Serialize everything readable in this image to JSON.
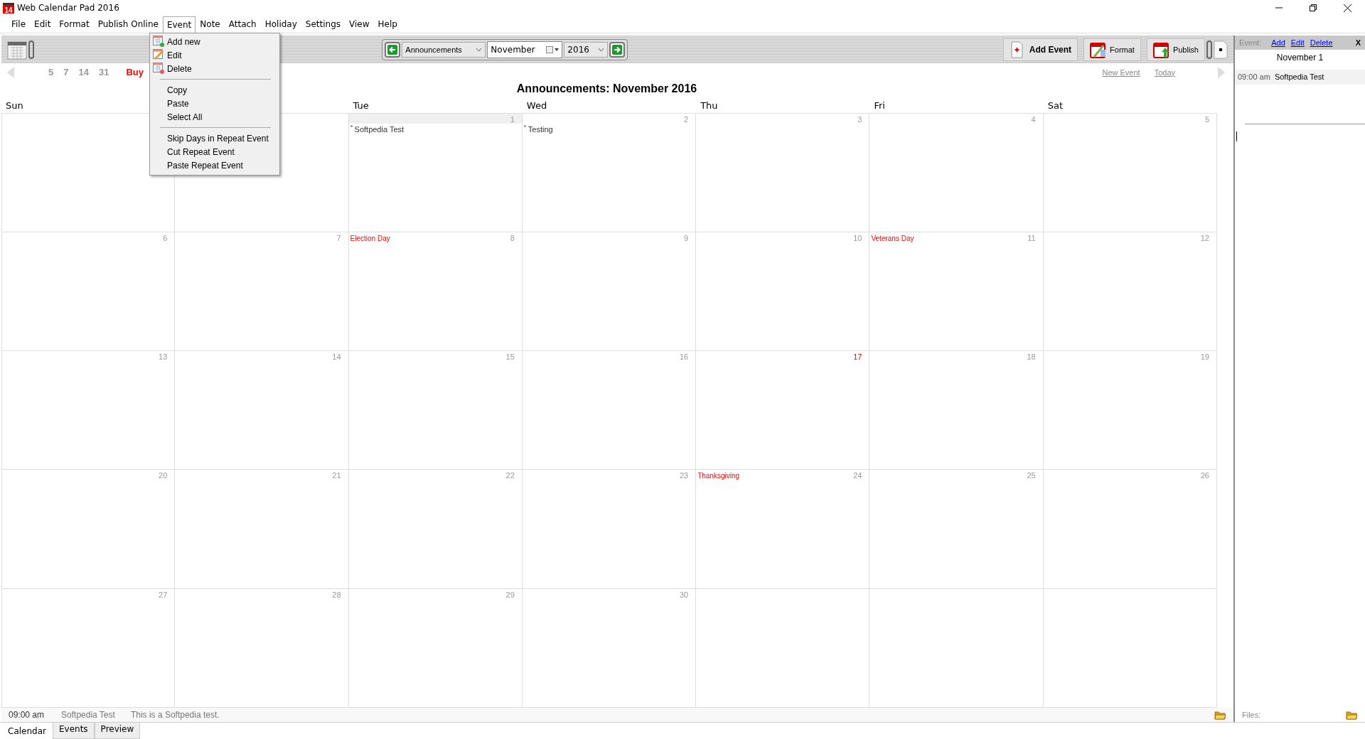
{
  "window": {
    "title": "Web Calendar Pad 2016",
    "app_icon_text": "14"
  },
  "menu": [
    {
      "label": "File",
      "selected": false
    },
    {
      "label": "Edit",
      "selected": false
    },
    {
      "label": "Format",
      "selected": false
    },
    {
      "label": "Publish Online",
      "selected": false
    },
    {
      "label": "Event",
      "selected": true
    },
    {
      "label": "Note",
      "selected": false
    },
    {
      "label": "Attach",
      "selected": false
    },
    {
      "label": "Holiday",
      "selected": false
    },
    {
      "label": "Settings",
      "selected": false
    },
    {
      "label": "View",
      "selected": false
    },
    {
      "label": "Help",
      "selected": false
    }
  ],
  "event_menu": [
    {
      "kind": "item",
      "label": "Add new"
    },
    {
      "kind": "item",
      "label": "Edit"
    },
    {
      "kind": "item",
      "label": "Delete"
    },
    {
      "kind": "separator"
    },
    {
      "kind": "item",
      "label": "Copy"
    },
    {
      "kind": "item",
      "label": "Paste"
    },
    {
      "kind": "item",
      "label": "Select All"
    },
    {
      "kind": "separator"
    },
    {
      "kind": "item",
      "label": "Skip Days in Repeat Event"
    },
    {
      "kind": "item",
      "label": "Cut Repeat Event"
    },
    {
      "kind": "item",
      "label": "Paste Repeat Event"
    }
  ],
  "toolbar": {
    "calendar_select": "Announcements",
    "month": "November",
    "year": "2016",
    "buttons": [
      "Add Event",
      "Format",
      "Publish"
    ]
  },
  "nav": {
    "ranges": [
      "5",
      "7",
      "14",
      "31"
    ],
    "buy": "Buy",
    "links": [
      "New Event",
      "Today"
    ]
  },
  "calendar": {
    "title": "Announcements:  November 2016",
    "weekdays": [
      {
        "kind": "label",
        "label": "Sun"
      },
      {
        "kind": "covered"
      },
      {
        "kind": "label",
        "label": "Tue"
      },
      {
        "kind": "label",
        "label": "Wed"
      },
      {
        "kind": "label",
        "label": "Thu"
      },
      {
        "kind": "label",
        "label": "Fri"
      },
      {
        "kind": "label",
        "label": "Sat"
      }
    ],
    "weeks": [
      [
        {
          "day": "1",
          "selected": true,
          "today": false,
          "events": [
            "Softpedia Test"
          ]
        },
        {
          "day": "2",
          "selected": false,
          "today": false,
          "events": [
            "Testing"
          ]
        },
        {
          "day": "3",
          "selected": false,
          "today": false
        },
        {
          "day": "4",
          "selected": false,
          "today": false
        },
        {
          "day": "5",
          "selected": false,
          "today": false
        }
      ],
      [
        {
          "day": "6",
          "selected": false,
          "today": false
        },
        {
          "day": "7",
          "selected": false,
          "today": false
        },
        {
          "day": "8",
          "selected": false,
          "today": false,
          "holiday": "Election Day"
        },
        {
          "day": "9",
          "selected": false,
          "today": false
        },
        {
          "day": "10",
          "selected": false,
          "today": false
        },
        {
          "day": "11",
          "selected": false,
          "today": false,
          "holiday": "Veterans Day"
        },
        {
          "day": "12",
          "selected": false,
          "today": false
        }
      ],
      [
        {
          "day": "13",
          "selected": false,
          "today": false
        },
        {
          "day": "14",
          "selected": false,
          "today": false
        },
        {
          "day": "15",
          "selected": false,
          "today": false
        },
        {
          "day": "16",
          "selected": false,
          "today": false
        },
        {
          "day": "17",
          "selected": false,
          "today": true
        },
        {
          "day": "18",
          "selected": false,
          "today": false
        },
        {
          "day": "19",
          "selected": false,
          "today": false
        }
      ],
      [
        {
          "day": "20",
          "selected": false,
          "today": false
        },
        {
          "day": "21",
          "selected": false,
          "today": false
        },
        {
          "day": "22",
          "selected": false,
          "today": false
        },
        {
          "day": "23",
          "selected": false,
          "today": false
        },
        {
          "day": "24",
          "selected": false,
          "today": false,
          "holiday": "Thanksgiving"
        },
        {
          "day": "25",
          "selected": false,
          "today": false
        },
        {
          "day": "26",
          "selected": false,
          "today": false
        }
      ],
      [
        {
          "day": "27",
          "selected": false,
          "today": false
        },
        {
          "day": "28",
          "selected": false,
          "today": false
        },
        {
          "day": "29",
          "selected": false,
          "today": false
        },
        {
          "day": "30",
          "selected": false,
          "today": false
        }
      ]
    ]
  },
  "status": {
    "time": "09:00 am",
    "title": "Softpedia Test",
    "description": "This is a Softpedia test."
  },
  "side_panel": {
    "label": "Event:",
    "links": [
      "Add",
      "Edit",
      "Delete"
    ],
    "close": "X",
    "date": "November 1",
    "events": [
      {
        "time": "09:00 am",
        "title": "Softpedia Test"
      }
    ],
    "files_label": "Files:"
  },
  "tabs": [
    {
      "label": "Calendar",
      "selected": true
    },
    {
      "label": "Events",
      "selected": false
    },
    {
      "label": "Preview",
      "selected": false
    }
  ]
}
